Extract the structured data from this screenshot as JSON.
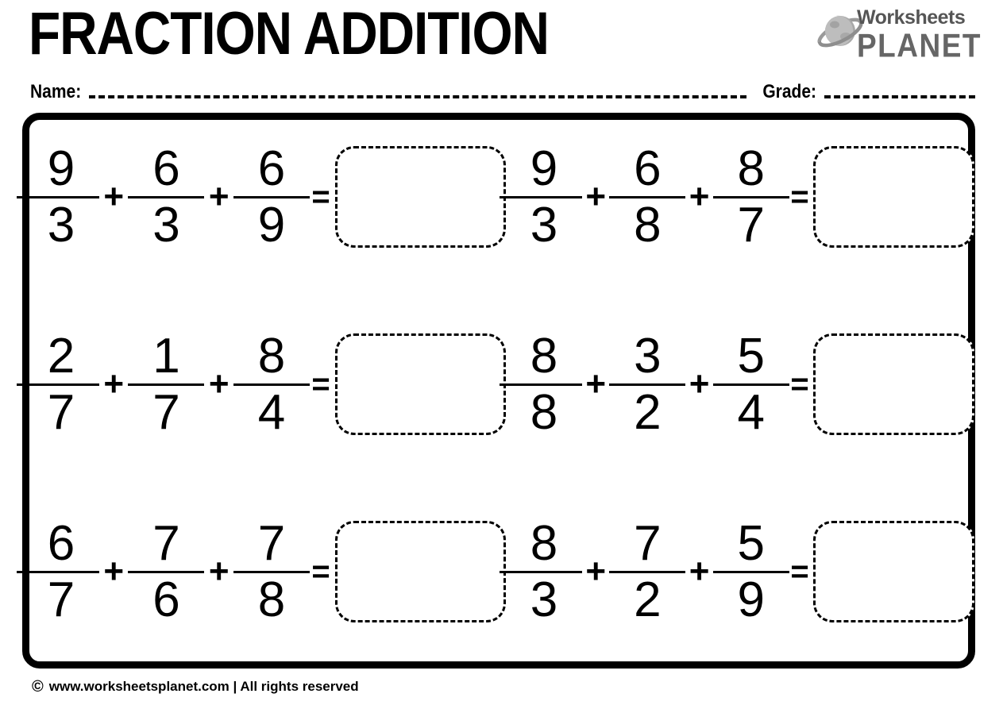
{
  "header": {
    "title": "FRACTION ADDITION",
    "logo": {
      "icon": "saturn-planet-icon",
      "line1": "Worksheets",
      "line2": "PLANET",
      "color": "#666666"
    }
  },
  "meta": {
    "name_label": "Name:",
    "name_value": "",
    "grade_label": "Grade:",
    "grade_value": ""
  },
  "operators": {
    "plus": "+",
    "equals": "="
  },
  "problems": [
    {
      "id": "p1",
      "terms": [
        {
          "numerator": "9",
          "denominator": "3"
        },
        {
          "numerator": "6",
          "denominator": "3"
        },
        {
          "numerator": "6",
          "denominator": "9"
        }
      ],
      "answer": ""
    },
    {
      "id": "p2",
      "terms": [
        {
          "numerator": "9",
          "denominator": "3"
        },
        {
          "numerator": "6",
          "denominator": "8"
        },
        {
          "numerator": "8",
          "denominator": "7"
        }
      ],
      "answer": ""
    },
    {
      "id": "p3",
      "terms": [
        {
          "numerator": "2",
          "denominator": "7"
        },
        {
          "numerator": "1",
          "denominator": "7"
        },
        {
          "numerator": "8",
          "denominator": "4"
        }
      ],
      "answer": ""
    },
    {
      "id": "p4",
      "terms": [
        {
          "numerator": "8",
          "denominator": "8"
        },
        {
          "numerator": "3",
          "denominator": "2"
        },
        {
          "numerator": "5",
          "denominator": "4"
        }
      ],
      "answer": ""
    },
    {
      "id": "p5",
      "terms": [
        {
          "numerator": "6",
          "denominator": "7"
        },
        {
          "numerator": "7",
          "denominator": "6"
        },
        {
          "numerator": "7",
          "denominator": "8"
        }
      ],
      "answer": ""
    },
    {
      "id": "p6",
      "terms": [
        {
          "numerator": "8",
          "denominator": "3"
        },
        {
          "numerator": "7",
          "denominator": "2"
        },
        {
          "numerator": "5",
          "denominator": "9"
        }
      ],
      "answer": ""
    }
  ],
  "footer": {
    "copyright_symbol": "©",
    "text": "www.worksheetsplanet.com | All rights reserved"
  }
}
